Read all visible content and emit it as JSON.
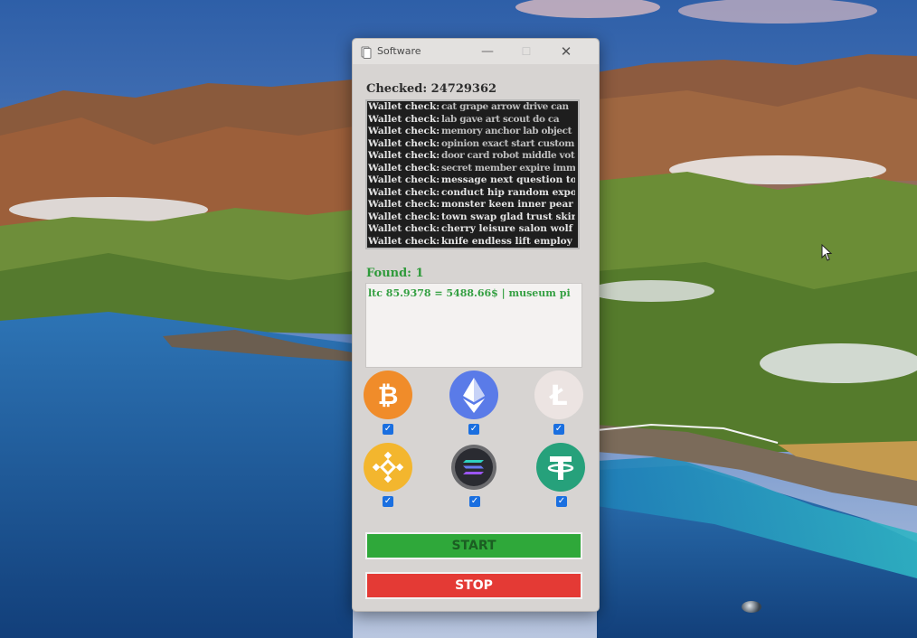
{
  "window": {
    "title": "Software",
    "controls": {
      "minimize": "—",
      "maximize": "☐",
      "close": "✕"
    }
  },
  "checked": {
    "text": "Checked: 24729362"
  },
  "log": {
    "rows": [
      {
        "label": "Wallet check:",
        "value": "cat grape arrow drive can"
      },
      {
        "label": "Wallet check:",
        "value": "lab gave art scout do ca"
      },
      {
        "label": "Wallet check:",
        "value": "memory anchor lab object"
      },
      {
        "label": "Wallet check:",
        "value": "opinion exact start custom"
      },
      {
        "label": "Wallet check:",
        "value": "door card robot middle vot"
      },
      {
        "label": "Wallet check:",
        "value": "secret member expire imme"
      },
      {
        "label": "Wallet check:",
        "value": "message next question ton"
      },
      {
        "label": "Wallet check:",
        "value": "conduct hip random expose"
      },
      {
        "label": "Wallet check:",
        "value": "monster keen inner pear c"
      },
      {
        "label": "Wallet check:",
        "value": "town swap glad trust skirt a"
      },
      {
        "label": "Wallet check:",
        "value": "cherry leisure salon wolf res"
      },
      {
        "label": "Wallet check:",
        "value": "knife endless lift employ for"
      }
    ]
  },
  "found": {
    "label": "Found: 1",
    "line": "ltc 85.9378 = 5488.66$ | museum pi"
  },
  "coins": [
    {
      "name": "Bitcoin",
      "glyph": "₿",
      "color": "#f08c2a",
      "checked": true
    },
    {
      "name": "Ethereum",
      "glyph": "",
      "color": "#5a7be8",
      "checked": true
    },
    {
      "name": "Litecoin",
      "glyph": "Ł",
      "color": "#ece4e2",
      "checked": true
    },
    {
      "name": "BNB",
      "glyph": "",
      "color": "#f3b62e",
      "checked": true
    },
    {
      "name": "Solana",
      "glyph": "",
      "color": "#3c3e46",
      "checked": true
    },
    {
      "name": "Tether",
      "glyph": "₮",
      "color": "#26a17b",
      "checked": true
    }
  ],
  "buttons": {
    "start": "START",
    "stop": "STOP"
  }
}
